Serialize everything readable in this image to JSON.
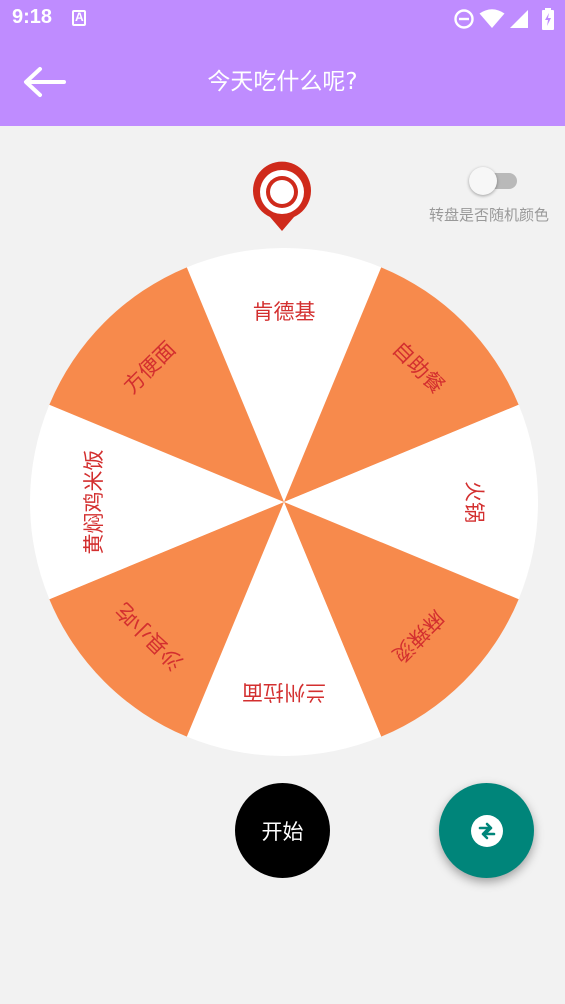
{
  "status_bar": {
    "time": "9:18",
    "icons": [
      "accessibility-a-icon",
      "do-not-disturb-icon",
      "wifi-icon",
      "signal-icon",
      "battery-icon"
    ]
  },
  "toolbar": {
    "title": "今天吃什么呢?",
    "back_icon": "arrow-left-icon",
    "background": "#bf8cff"
  },
  "pointer_icon": "map-pin-icon",
  "toggle": {
    "label": "转盘是否随机颜色",
    "checked": false
  },
  "wheel": {
    "segments": [
      {
        "label": "肯德基",
        "color": "#ffffff"
      },
      {
        "label": "自助餐",
        "color": "#f78a4c"
      },
      {
        "label": "火锅",
        "color": "#ffffff"
      },
      {
        "label": "麻辣烫",
        "color": "#f78a4c"
      },
      {
        "label": "兰州拉面",
        "color": "#ffffff"
      },
      {
        "label": "沙县小吃",
        "color": "#f78a4c"
      },
      {
        "label": "黄焖鸡米饭",
        "color": "#ffffff"
      },
      {
        "label": "方便面",
        "color": "#f78a4c"
      }
    ],
    "text_color": "#d32f2f"
  },
  "start_button": {
    "label": "开始"
  },
  "fab": {
    "icon": "swap-arrows-icon",
    "color": "#00857a"
  }
}
